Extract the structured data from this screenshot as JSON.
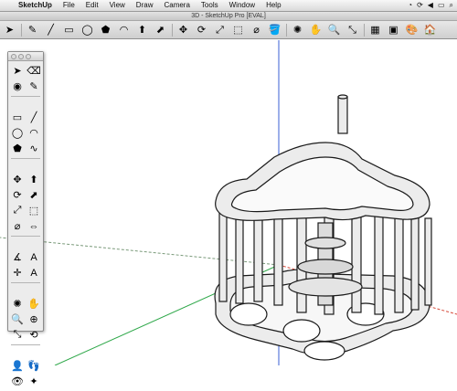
{
  "menubar": {
    "apple_icon": "apple-icon",
    "items": [
      "SketchUp",
      "File",
      "Edit",
      "View",
      "Draw",
      "Camera",
      "Tools",
      "Window",
      "Help"
    ]
  },
  "window": {
    "title": "3D - SketchUp Pro [EVAL]"
  },
  "toolbar": {
    "icons": [
      "select-arrow-icon",
      "eraser-icon",
      "pencil-line-icon",
      "rectangle-icon",
      "circle-icon",
      "polygon-icon",
      "arc-icon",
      "push-pull-icon",
      "follow-me-icon",
      "move-icon",
      "rotate-icon",
      "scale-icon",
      "offset-icon",
      "tape-measure-icon",
      "paint-bucket-icon",
      "orbit-icon",
      "pan-icon",
      "zoom-icon",
      "zoom-extents-icon",
      "section-plane-icon",
      "components-icon",
      "materials-icon",
      "warehouse-icon"
    ],
    "glyphs": [
      "➤",
      "✎",
      "╱",
      "▭",
      "◯",
      "⬟",
      "◠",
      "⬆",
      "⬈",
      "✥",
      "⟳",
      "⤢",
      "⬚",
      "⌀",
      "🪣",
      "✺",
      "✋",
      "🔍",
      "⤡",
      "▦",
      "▣",
      "🎨",
      "🏠"
    ]
  },
  "palette": {
    "groups": [
      [
        [
          "select-icon",
          "➤"
        ],
        [
          "eraser-icon",
          "⌫"
        ]
      ],
      [
        [
          "paint-bucket-icon",
          "◉"
        ],
        [
          "pencil-icon",
          "✎"
        ]
      ],
      [
        [
          "rectangle-icon",
          "▭"
        ],
        [
          "line-icon",
          "╱"
        ]
      ],
      [
        [
          "circle-icon",
          "◯"
        ],
        [
          "arc-icon",
          "◠"
        ]
      ],
      [
        [
          "polygon-icon",
          "⬟"
        ],
        [
          "freehand-icon",
          "∿"
        ]
      ],
      [
        [
          "move-icon",
          "✥"
        ],
        [
          "push-pull-icon",
          "⬆"
        ]
      ],
      [
        [
          "rotate-icon",
          "⟳"
        ],
        [
          "follow-me-icon",
          "⬈"
        ]
      ],
      [
        [
          "scale-icon",
          "⤢"
        ],
        [
          "offset-icon",
          "⬚"
        ]
      ],
      [
        [
          "tape-measure-icon",
          "⌀"
        ],
        [
          "dimension-icon",
          "⇔"
        ]
      ],
      [
        [
          "protractor-icon",
          "∡"
        ],
        [
          "text-icon",
          "A"
        ]
      ],
      [
        [
          "axes-icon",
          "✛"
        ],
        [
          "3d-text-icon",
          "A"
        ]
      ],
      [
        [
          "orbit-icon",
          "✺"
        ],
        [
          "pan-icon",
          "✋"
        ]
      ],
      [
        [
          "zoom-icon",
          "🔍"
        ],
        [
          "zoom-window-icon",
          "⊕"
        ]
      ],
      [
        [
          "zoom-extents-icon",
          "⤡"
        ],
        [
          "previous-view-icon",
          "⟲"
        ]
      ],
      [
        [
          "position-camera-icon",
          "👤"
        ],
        [
          "walk-icon",
          "👣"
        ]
      ],
      [
        [
          "look-around-icon",
          "👁"
        ],
        [
          "section-plane-icon",
          "✦"
        ]
      ]
    ]
  },
  "colors": {
    "axis_blue": "#3a5fd6",
    "axis_green": "#2fa84a",
    "axis_red": "#d64a3a",
    "model_face": "#ececec",
    "model_edge": "#1a1a1a"
  }
}
